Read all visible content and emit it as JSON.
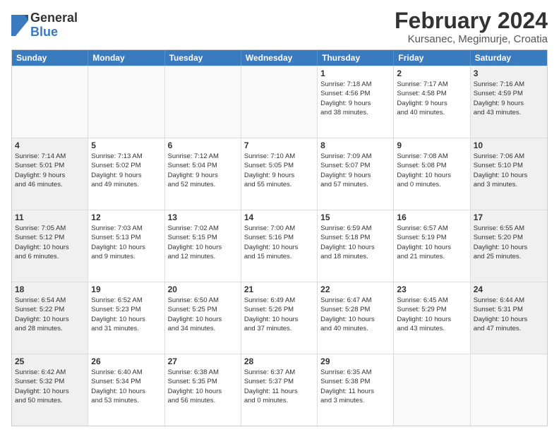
{
  "logo": {
    "general": "General",
    "blue": "Blue"
  },
  "title": "February 2024",
  "subtitle": "Kursanec, Megimurje, Croatia",
  "header_days": [
    "Sunday",
    "Monday",
    "Tuesday",
    "Wednesday",
    "Thursday",
    "Friday",
    "Saturday"
  ],
  "weeks": [
    [
      {
        "day": "",
        "info": "",
        "empty": true
      },
      {
        "day": "",
        "info": "",
        "empty": true
      },
      {
        "day": "",
        "info": "",
        "empty": true
      },
      {
        "day": "",
        "info": "",
        "empty": true
      },
      {
        "day": "1",
        "info": "Sunrise: 7:18 AM\nSunset: 4:56 PM\nDaylight: 9 hours\nand 38 minutes.",
        "empty": false
      },
      {
        "day": "2",
        "info": "Sunrise: 7:17 AM\nSunset: 4:58 PM\nDaylight: 9 hours\nand 40 minutes.",
        "empty": false
      },
      {
        "day": "3",
        "info": "Sunrise: 7:16 AM\nSunset: 4:59 PM\nDaylight: 9 hours\nand 43 minutes.",
        "empty": false,
        "shaded": true
      }
    ],
    [
      {
        "day": "4",
        "info": "Sunrise: 7:14 AM\nSunset: 5:01 PM\nDaylight: 9 hours\nand 46 minutes.",
        "shaded": true
      },
      {
        "day": "5",
        "info": "Sunrise: 7:13 AM\nSunset: 5:02 PM\nDaylight: 9 hours\nand 49 minutes."
      },
      {
        "day": "6",
        "info": "Sunrise: 7:12 AM\nSunset: 5:04 PM\nDaylight: 9 hours\nand 52 minutes."
      },
      {
        "day": "7",
        "info": "Sunrise: 7:10 AM\nSunset: 5:05 PM\nDaylight: 9 hours\nand 55 minutes."
      },
      {
        "day": "8",
        "info": "Sunrise: 7:09 AM\nSunset: 5:07 PM\nDaylight: 9 hours\nand 57 minutes."
      },
      {
        "day": "9",
        "info": "Sunrise: 7:08 AM\nSunset: 5:08 PM\nDaylight: 10 hours\nand 0 minutes."
      },
      {
        "day": "10",
        "info": "Sunrise: 7:06 AM\nSunset: 5:10 PM\nDaylight: 10 hours\nand 3 minutes.",
        "shaded": true
      }
    ],
    [
      {
        "day": "11",
        "info": "Sunrise: 7:05 AM\nSunset: 5:12 PM\nDaylight: 10 hours\nand 6 minutes.",
        "shaded": true
      },
      {
        "day": "12",
        "info": "Sunrise: 7:03 AM\nSunset: 5:13 PM\nDaylight: 10 hours\nand 9 minutes."
      },
      {
        "day": "13",
        "info": "Sunrise: 7:02 AM\nSunset: 5:15 PM\nDaylight: 10 hours\nand 12 minutes."
      },
      {
        "day": "14",
        "info": "Sunrise: 7:00 AM\nSunset: 5:16 PM\nDaylight: 10 hours\nand 15 minutes."
      },
      {
        "day": "15",
        "info": "Sunrise: 6:59 AM\nSunset: 5:18 PM\nDaylight: 10 hours\nand 18 minutes."
      },
      {
        "day": "16",
        "info": "Sunrise: 6:57 AM\nSunset: 5:19 PM\nDaylight: 10 hours\nand 21 minutes."
      },
      {
        "day": "17",
        "info": "Sunrise: 6:55 AM\nSunset: 5:20 PM\nDaylight: 10 hours\nand 25 minutes.",
        "shaded": true
      }
    ],
    [
      {
        "day": "18",
        "info": "Sunrise: 6:54 AM\nSunset: 5:22 PM\nDaylight: 10 hours\nand 28 minutes.",
        "shaded": true
      },
      {
        "day": "19",
        "info": "Sunrise: 6:52 AM\nSunset: 5:23 PM\nDaylight: 10 hours\nand 31 minutes."
      },
      {
        "day": "20",
        "info": "Sunrise: 6:50 AM\nSunset: 5:25 PM\nDaylight: 10 hours\nand 34 minutes."
      },
      {
        "day": "21",
        "info": "Sunrise: 6:49 AM\nSunset: 5:26 PM\nDaylight: 10 hours\nand 37 minutes."
      },
      {
        "day": "22",
        "info": "Sunrise: 6:47 AM\nSunset: 5:28 PM\nDaylight: 10 hours\nand 40 minutes."
      },
      {
        "day": "23",
        "info": "Sunrise: 6:45 AM\nSunset: 5:29 PM\nDaylight: 10 hours\nand 43 minutes."
      },
      {
        "day": "24",
        "info": "Sunrise: 6:44 AM\nSunset: 5:31 PM\nDaylight: 10 hours\nand 47 minutes.",
        "shaded": true
      }
    ],
    [
      {
        "day": "25",
        "info": "Sunrise: 6:42 AM\nSunset: 5:32 PM\nDaylight: 10 hours\nand 50 minutes.",
        "shaded": true
      },
      {
        "day": "26",
        "info": "Sunrise: 6:40 AM\nSunset: 5:34 PM\nDaylight: 10 hours\nand 53 minutes."
      },
      {
        "day": "27",
        "info": "Sunrise: 6:38 AM\nSunset: 5:35 PM\nDaylight: 10 hours\nand 56 minutes."
      },
      {
        "day": "28",
        "info": "Sunrise: 6:37 AM\nSunset: 5:37 PM\nDaylight: 11 hours\nand 0 minutes."
      },
      {
        "day": "29",
        "info": "Sunrise: 6:35 AM\nSunset: 5:38 PM\nDaylight: 11 hours\nand 3 minutes."
      },
      {
        "day": "",
        "info": "",
        "empty": true
      },
      {
        "day": "",
        "info": "",
        "empty": true,
        "shaded": true
      }
    ]
  ]
}
